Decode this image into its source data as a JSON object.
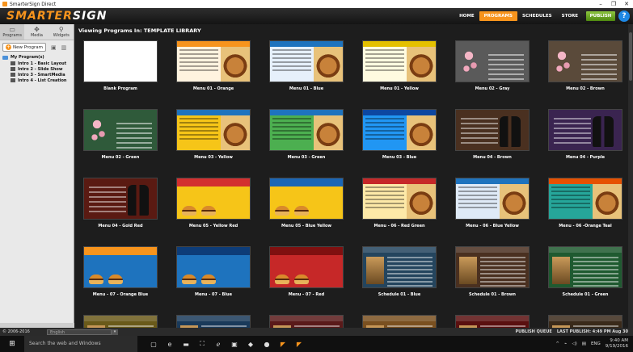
{
  "window": {
    "title": "SmarterSign Direct"
  },
  "header": {
    "logo_left": "SMARTER",
    "logo_right": "SIGN",
    "nav": [
      {
        "label": "HOME",
        "active": false
      },
      {
        "label": "PROGRAMS",
        "active": true
      },
      {
        "label": "SCHEDULES",
        "active": false
      },
      {
        "label": "STORE",
        "active": false
      }
    ],
    "publish_label": "PUBLISH",
    "help_label": "?"
  },
  "left_panel": {
    "tools": [
      {
        "label": "Programs",
        "icon": "screen-icon"
      },
      {
        "label": "Media",
        "icon": "media-icon"
      },
      {
        "label": "Widgets",
        "icon": "widgets-icon"
      }
    ],
    "new_program_label": "New Program",
    "tree": {
      "root": "My Program(s)",
      "items": [
        "Intro 1 - Basic Layout",
        "Intro 2 - Slide Show",
        "Intro 3 - SmartMedia",
        "Intro 4 - List Creation"
      ]
    }
  },
  "main": {
    "title_prefix": "Viewing Programs In:",
    "title_library": "TEMPLATE LIBRARY",
    "templates": [
      {
        "label": "Blank Program",
        "style": "blank"
      },
      {
        "label": "Menu 01 - Orange",
        "style": "menu",
        "bar": "#f7941d",
        "bg": "#fff3df"
      },
      {
        "label": "Menu 01 - Blue",
        "style": "menu",
        "bar": "#1e73be",
        "bg": "#e6f0fb"
      },
      {
        "label": "Menu 01 - Yellow",
        "style": "menu",
        "bar": "#e5c100",
        "bg": "#fffbe0"
      },
      {
        "label": "Menu 02 - Gray",
        "style": "dark",
        "bg": "#5a5a5a"
      },
      {
        "label": "Menu 02 - Brown",
        "style": "dark",
        "bg": "#5a4a3a"
      },
      {
        "label": "Menu 02 - Green",
        "style": "dark",
        "bg": "#2f5a3a"
      },
      {
        "label": "Menu 03 - Yellow",
        "style": "menu",
        "bar": "#1e73be",
        "bg": "#f6c518"
      },
      {
        "label": "Menu 03 - Green",
        "style": "menu",
        "bar": "#1e73be",
        "bg": "#4caf50"
      },
      {
        "label": "Menu 03 - Blue",
        "style": "menu",
        "bar": "#0d47a1",
        "bg": "#2196f3"
      },
      {
        "label": "Menu 04 - Brown",
        "style": "wine",
        "bg": "#4a3020"
      },
      {
        "label": "Menu 04 - Purple",
        "style": "wine",
        "bg": "#3a2450"
      },
      {
        "label": "Menu 04 - Gold Red",
        "style": "wine",
        "bg": "#5a1a12"
      },
      {
        "label": "Menu 05 - Yellow Red",
        "style": "burger",
        "bg": "#f6c518",
        "strip": "#d32f2f"
      },
      {
        "label": "Menu 05 - Blue Yellow",
        "style": "burger",
        "bg": "#f6c518",
        "strip": "#1a66b5"
      },
      {
        "label": "Menu - 06 - Red Green",
        "style": "menu",
        "bar": "#c62828",
        "bg": "#fde9a8"
      },
      {
        "label": "Menu - 06 - Blue Yellow",
        "style": "menu",
        "bar": "#1e73be",
        "bg": "#dfeaf7"
      },
      {
        "label": "Menu - 06 -Orange Teal",
        "style": "menu",
        "bar": "#e65100",
        "bg": "#26a69a"
      },
      {
        "label": "Menu - 07 - Orange Blue",
        "style": "burger",
        "bg": "#1e73be",
        "strip": "#f7941d"
      },
      {
        "label": "Menu - 07 - Blue",
        "style": "burger",
        "bg": "#1e73be",
        "strip": "#0d3c78"
      },
      {
        "label": "Menu - 07 - Red",
        "style": "burger",
        "bg": "#c62828",
        "strip": "#7f1010"
      },
      {
        "label": "Schedule 01 - Blue",
        "style": "sched",
        "bg": "#24455e"
      },
      {
        "label": "Schedule 01 - Brown",
        "style": "sched",
        "bg": "#4a3020"
      },
      {
        "label": "Schedule 01 - Green",
        "style": "sched",
        "bg": "#1f5a30"
      },
      {
        "label": "",
        "style": "sched",
        "bg": "#6a5a1a"
      },
      {
        "label": "",
        "style": "sched",
        "bg": "#1a3a5a"
      },
      {
        "label": "",
        "style": "sched",
        "bg": "#5a1a1a"
      },
      {
        "label": "",
        "style": "sched",
        "bg": "#7a5020"
      },
      {
        "label": "",
        "style": "sched",
        "bg": "#5a1010"
      },
      {
        "label": "",
        "style": "sched",
        "bg": "#3a2a1a"
      }
    ]
  },
  "status": {
    "copyright": "© 2006-2016",
    "language": "English",
    "publish_queue": "PUBLISH QUEUE",
    "last_publish": "LAST PUBLISH: 4:49 PM Aug 30"
  },
  "taskbar": {
    "search_placeholder": "Search the web and Windows",
    "lang": "ENG",
    "time": "9:40 AM",
    "date": "9/19/2016"
  }
}
